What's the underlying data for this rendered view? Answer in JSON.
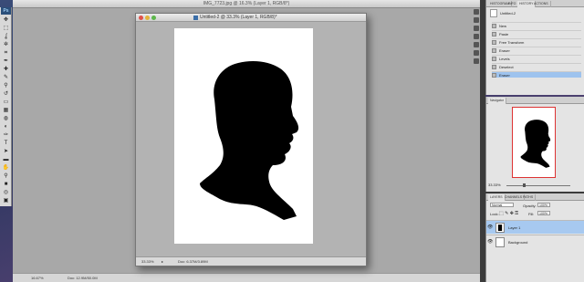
{
  "toolbox": {
    "logo": "Ps",
    "tools": [
      "move-icon",
      "marquee-icon",
      "lasso-icon",
      "magic-wand-icon",
      "crop-icon",
      "eyedropper-icon",
      "healing-icon",
      "brush-icon",
      "stamp-icon",
      "history-brush-icon",
      "eraser-icon",
      "gradient-icon",
      "blur-icon",
      "dodge-icon",
      "pen-icon",
      "type-icon",
      "path-select-icon",
      "shape-icon",
      "hand-icon",
      "zoom-icon",
      "color-swatch-icon",
      "quick-mask-icon",
      "screen-mode-icon"
    ],
    "glyphs": [
      "✥",
      "⬚",
      "ʆ",
      "✲",
      "⌗",
      "✒",
      "✚",
      "✎",
      "⚲",
      "↺",
      "▭",
      "▦",
      "◍",
      "◐",
      "✑",
      "T",
      "➤",
      "▬",
      "✋",
      "⚲",
      "■",
      "◎",
      "▣"
    ]
  },
  "background_doc": {
    "title": "IMG_7723.jpg @ 16.3% (Layer 1, RGB/8*)",
    "zoom": "16.67%",
    "doc_size": "Doc: 12.9M/50.0M"
  },
  "document": {
    "title": "Untitled-2 @ 33.3% (Layer 1, RGB/8)*",
    "zoom": "33.33%",
    "doc_size": "Doc: 6.37M/3.89M",
    "canvas_color": "#ffffff",
    "silhouette_color": "#000000"
  },
  "history_panel": {
    "tabs": [
      "HISTOGRAM",
      "INFO",
      "HISTORY",
      "ACTIONS"
    ],
    "active_tab": "HISTORY",
    "snapshot": "Untitled-2",
    "items": [
      {
        "label": "New",
        "selected": false
      },
      {
        "label": "Paste",
        "selected": false
      },
      {
        "label": "Free Transform",
        "selected": false
      },
      {
        "label": "Eraser",
        "selected": false
      },
      {
        "label": "Levels",
        "selected": false
      },
      {
        "label": "Deselect",
        "selected": false
      },
      {
        "label": "Eraser",
        "selected": true
      }
    ]
  },
  "navigator_panel": {
    "tab": "Navigator",
    "zoom": "33.33%",
    "frame_color": "#dd3333"
  },
  "layers_panel": {
    "tabs": [
      "LAYERS",
      "CHANNELS",
      "PATHS"
    ],
    "blend_mode": "Normal",
    "opacity_label": "Opacity:",
    "opacity": "100%",
    "lock_label": "Lock:",
    "fill_label": "Fill:",
    "fill": "100%",
    "layers": [
      {
        "name": "Layer 1",
        "selected": true
      },
      {
        "name": "Background",
        "selected": false
      }
    ]
  }
}
